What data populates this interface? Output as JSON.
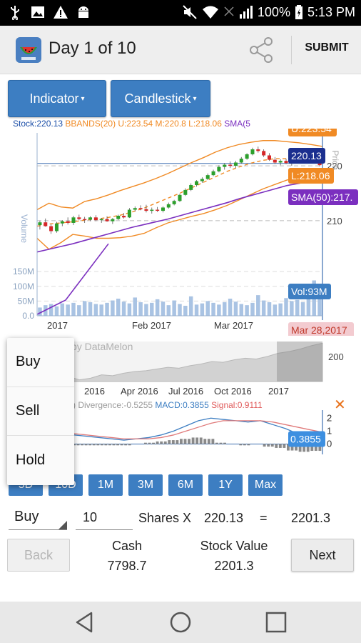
{
  "status_bar": {
    "battery_percent": "100%",
    "time": "5:13 PM",
    "left_icons": [
      "usb-icon",
      "image-icon",
      "warning-icon",
      "android-icon"
    ],
    "right_icons": [
      "mute-icon",
      "wifi-icon",
      "no-signal-icon",
      "signal-icon",
      "battery-icon"
    ]
  },
  "appbar": {
    "title": "Day 1 of 10",
    "submit_label": "SUBMIT"
  },
  "toolbar": {
    "indicator_label": "Indicator",
    "chart_type_label": "Candlestick"
  },
  "chart_info": {
    "stock": "Stock:220.13",
    "bbands": "BBANDS(20) U:223.54 M:220.8 L:218.06",
    "sma": "SMA(5"
  },
  "chart_tags": {
    "upper": "U:223.54",
    "price": "220.13",
    "lower": "L:218.06",
    "sma": "SMA(50):217.",
    "volume": "Vol:93M",
    "date": "Mar 28,2017"
  },
  "mini_chart": {
    "watermark": "by DataMelon",
    "right_label": "200",
    "x_labels": [
      "2016",
      "Apr 2016",
      "Jul 2016",
      "Oct 2016",
      "2017"
    ]
  },
  "macd": {
    "info_divergence": ") Divergence:-0.5255",
    "info_macd": "MACD:0.3855",
    "info_signal": "Signal:0.9111",
    "tag": "0.3855",
    "y_labels": [
      "2",
      "1",
      "0"
    ]
  },
  "range_buttons": [
    "5D",
    "10D",
    "1M",
    "3M",
    "6M",
    "1Y",
    "Max"
  ],
  "popup_menu": [
    "Buy",
    "Sell",
    "Hold"
  ],
  "trade": {
    "action": "Buy",
    "shares": "10",
    "shares_label": "Shares X",
    "price": "220.13",
    "equals": "=",
    "total": "2201.3"
  },
  "account": {
    "back_label": "Back",
    "cash_label": "Cash",
    "cash_value": "7798.7",
    "stock_value_label": "Stock Value",
    "stock_value": "2201.3",
    "next_label": "Next"
  },
  "colors": {
    "accent": "#3d7ec2",
    "up_candle": "#2ca02c",
    "down_candle": "#d62728",
    "bbands": "#f08a24",
    "sma": "#7b2fbf",
    "price_tag": "#1b2f8f",
    "volume": "#a9c3e3",
    "macd_tag": "#3d8fe0",
    "close_x": "#e8711a",
    "date_tag": "#f3cbd0"
  },
  "chart_data": [
    {
      "type": "candlestick",
      "title": "",
      "ylabel": "Price",
      "y2label": "Volume",
      "x_labels": [
        "2017",
        "Feb 2017",
        "Mar 2017"
      ],
      "y_ticks": [
        210,
        220
      ],
      "volume_ticks": [
        "0.0",
        "50M",
        "100M",
        "150M"
      ],
      "ylim": [
        204,
        226
      ],
      "ohlc": [
        [
          209.2,
          210.0,
          208.4,
          209.7
        ],
        [
          209.7,
          210.4,
          208.9,
          209.0
        ],
        [
          209.0,
          209.4,
          207.6,
          208.1
        ],
        [
          208.1,
          209.8,
          207.8,
          209.5
        ],
        [
          209.5,
          210.1,
          209.0,
          209.9
        ],
        [
          209.9,
          210.6,
          209.3,
          209.6
        ],
        [
          209.6,
          210.9,
          209.2,
          210.6
        ],
        [
          210.6,
          211.1,
          210.1,
          210.3
        ],
        [
          210.3,
          210.7,
          209.6,
          210.2
        ],
        [
          210.2,
          210.8,
          209.9,
          210.6
        ],
        [
          210.6,
          211.0,
          209.9,
          210.1
        ],
        [
          210.1,
          210.5,
          209.6,
          210.3
        ],
        [
          210.3,
          210.8,
          209.8,
          209.9
        ],
        [
          209.9,
          210.5,
          209.4,
          210.3
        ],
        [
          210.3,
          211.1,
          210.1,
          210.9
        ],
        [
          210.9,
          211.4,
          210.4,
          210.6
        ],
        [
          210.6,
          212.3,
          210.5,
          212.0
        ],
        [
          212.0,
          212.6,
          211.7,
          212.3
        ],
        [
          212.3,
          212.8,
          211.9,
          212.1
        ],
        [
          212.1,
          212.9,
          211.5,
          211.8
        ],
        [
          211.8,
          212.4,
          211.3,
          212.0
        ],
        [
          212.0,
          212.5,
          211.6,
          211.8
        ],
        [
          211.8,
          212.6,
          211.5,
          212.4
        ],
        [
          212.4,
          213.3,
          212.2,
          213.0
        ],
        [
          213.0,
          213.8,
          212.8,
          213.6
        ],
        [
          213.6,
          214.9,
          213.4,
          214.7
        ],
        [
          214.7,
          215.9,
          214.5,
          215.6
        ],
        [
          215.6,
          216.8,
          215.4,
          216.5
        ],
        [
          216.5,
          217.4,
          216.2,
          217.2
        ],
        [
          217.2,
          217.9,
          216.9,
          217.6
        ],
        [
          217.6,
          218.6,
          217.4,
          218.3
        ],
        [
          218.3,
          219.3,
          218.1,
          219.0
        ],
        [
          219.0,
          220.1,
          218.8,
          219.8
        ],
        [
          219.8,
          220.5,
          219.3,
          220.2
        ],
        [
          220.2,
          220.8,
          219.6,
          220.0
        ],
        [
          220.0,
          220.9,
          219.6,
          220.6
        ],
        [
          220.6,
          221.6,
          220.4,
          221.3
        ],
        [
          221.3,
          222.3,
          221.1,
          222.1
        ],
        [
          222.1,
          223.3,
          221.9,
          223.0
        ],
        [
          223.0,
          223.5,
          222.4,
          222.7
        ],
        [
          222.7,
          223.0,
          221.6,
          221.9
        ],
        [
          221.9,
          222.3,
          220.9,
          221.1
        ],
        [
          221.1,
          221.6,
          220.3,
          220.6
        ],
        [
          220.6,
          221.2,
          220.1,
          220.9
        ],
        [
          220.9,
          221.3,
          220.3,
          220.5
        ],
        [
          220.5,
          221.0,
          220.0,
          220.7
        ],
        [
          220.7,
          221.5,
          220.4,
          221.2
        ],
        [
          221.2,
          222.9,
          221.0,
          222.6
        ],
        [
          222.6,
          223.0,
          221.7,
          222.0
        ],
        [
          222.0,
          222.4,
          220.8,
          221.2
        ],
        [
          221.2,
          221.7,
          219.9,
          220.13
        ]
      ],
      "upper_band": [
        212.0,
        213.2,
        212.5,
        212.3,
        213.5,
        214.0,
        214.7,
        215.5,
        216.2,
        216.9,
        217.7,
        218.6,
        219.6,
        220.6,
        221.5,
        222.5,
        223.3,
        223.9,
        224.3,
        224.6,
        224.6,
        224.4,
        224.2,
        223.9,
        223.54
      ],
      "middle_band": [
        209.0,
        209.4,
        209.6,
        209.8,
        210.1,
        210.3,
        210.6,
        211.0,
        211.6,
        212.3,
        213.2,
        214.1,
        215.0,
        216.0,
        217.0,
        218.0,
        219.0,
        219.8,
        220.5,
        221.0,
        221.3,
        221.3,
        221.2,
        221.0,
        220.8
      ],
      "lower_band": [
        206.8,
        204.8,
        206.0,
        207.5,
        207.2,
        206.8,
        206.8,
        206.9,
        207.2,
        207.7,
        208.7,
        209.6,
        210.2,
        210.8,
        211.3,
        212.0,
        212.8,
        213.8,
        214.8,
        215.8,
        216.6,
        217.4,
        217.9,
        218.0,
        218.06
      ],
      "sma50": [
        204.3,
        204.8,
        205.3,
        205.8,
        206.4,
        207.0,
        207.6,
        208.2,
        208.8,
        209.3,
        209.8,
        210.3,
        210.9,
        211.5,
        212.1,
        212.7,
        213.3,
        214.0,
        214.6,
        215.2,
        215.8,
        216.4,
        216.8,
        217.2,
        217.5
      ],
      "volume_m": [
        28,
        36,
        40,
        32,
        42,
        38,
        44,
        36,
        50,
        46,
        40,
        38,
        44,
        52,
        58,
        48,
        42,
        62,
        46,
        40,
        44,
        56,
        48,
        36,
        52,
        40,
        34,
        66,
        38,
        42,
        50,
        44,
        38,
        46,
        58,
        48,
        40,
        36,
        44,
        70,
        52,
        46,
        38,
        42,
        60,
        50,
        54,
        46,
        92,
        120,
        93
      ]
    },
    {
      "type": "area",
      "title": "",
      "x_labels": [
        "2016",
        "Apr 2016",
        "Jul 2016",
        "Oct 2016",
        "2017"
      ],
      "values": [
        186,
        182,
        184,
        188,
        187,
        190,
        192,
        193,
        195,
        197,
        196,
        199,
        201,
        204,
        203,
        206,
        208,
        207,
        210,
        214,
        216,
        219,
        223,
        226
      ]
    },
    {
      "type": "line",
      "title": "",
      "series": [
        {
          "name": "MACD",
          "values": [
            0.9,
            1.0,
            0.9,
            0.7,
            0.6,
            0.5,
            0.4,
            0.3,
            0.4,
            0.5,
            0.7,
            1.0,
            1.4,
            1.8,
            2.0,
            1.9,
            1.8,
            1.7,
            1.8,
            1.5,
            1.2,
            0.8,
            0.5,
            0.3855
          ]
        },
        {
          "name": "Signal",
          "values": [
            0.8,
            0.9,
            0.9,
            0.8,
            0.7,
            0.6,
            0.5,
            0.4,
            0.4,
            0.4,
            0.5,
            0.7,
            1.0,
            1.3,
            1.6,
            1.8,
            1.8,
            1.8,
            1.8,
            1.7,
            1.5,
            1.3,
            1.1,
            0.9111
          ]
        }
      ],
      "histogram": [
        0.1,
        0.1,
        0.0,
        -0.1,
        -0.1,
        -0.1,
        -0.1,
        -0.1,
        0.0,
        0.1,
        0.2,
        0.3,
        0.4,
        0.5,
        0.4,
        0.1,
        0.0,
        -0.1,
        0.0,
        -0.2,
        -0.3,
        -0.5,
        -0.6,
        -0.5255
      ],
      "y_ticks": [
        0,
        1,
        2
      ],
      "ylim": [
        -0.8,
        2.4
      ]
    }
  ]
}
